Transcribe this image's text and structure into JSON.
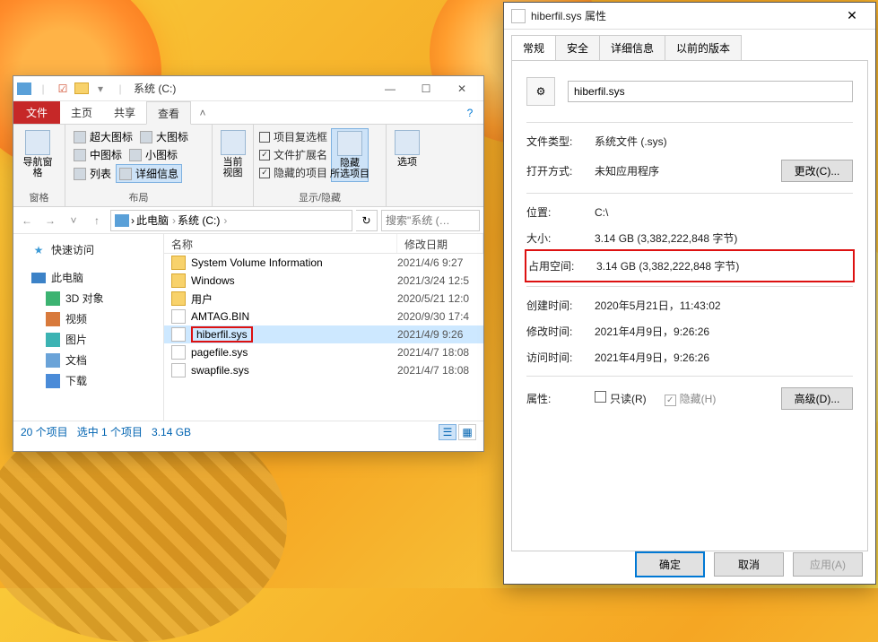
{
  "explorer": {
    "title": "系统 (C:)",
    "tabs": {
      "file": "文件",
      "home": "主页",
      "share": "共享",
      "view": "查看"
    },
    "ribbon": {
      "pane_group": "窗格",
      "nav_pane": "导航窗格",
      "layout_group": "布局",
      "xl_icons": "超大图标",
      "l_icons": "大图标",
      "m_icons": "中图标",
      "s_icons": "小图标",
      "list": "列表",
      "details": "详细信息",
      "current_view": "当前\n视图",
      "show_hide_group": "显示/隐藏",
      "chk_itemchk": "项目复选框",
      "chk_ext": "文件扩展名",
      "chk_hidden": "隐藏的项目",
      "hide_sel": "隐藏\n所选项目",
      "options": "选项"
    },
    "breadcrumbs": [
      "此电脑",
      "系统 (C:)"
    ],
    "search_placeholder": "搜索\"系统 (…",
    "nav": {
      "quick": "快速访问",
      "thispc": "此电脑",
      "objects3d": "3D 对象",
      "videos": "视频",
      "pictures": "图片",
      "documents": "文档",
      "downloads": "下载"
    },
    "columns": {
      "name": "名称",
      "date": "修改日期"
    },
    "rows": [
      {
        "type": "folder",
        "name": "System Volume Information",
        "date": "2021/4/6 9:27"
      },
      {
        "type": "folder",
        "name": "Windows",
        "date": "2021/3/24 12:5"
      },
      {
        "type": "folder",
        "name": "用户",
        "date": "2020/5/21 12:0"
      },
      {
        "type": "file",
        "name": "AMTAG.BIN",
        "date": "2020/9/30 17:4"
      },
      {
        "type": "file",
        "name": "hiberfil.sys",
        "date": "2021/4/9 9:26",
        "selected": true,
        "highlighted": true
      },
      {
        "type": "file",
        "name": "pagefile.sys",
        "date": "2021/4/7 18:08"
      },
      {
        "type": "file",
        "name": "swapfile.sys",
        "date": "2021/4/7 18:08"
      }
    ],
    "status": {
      "count": "20 个项目",
      "selected": "选中 1 个项目",
      "size": "3.14 GB"
    }
  },
  "props": {
    "title": "hiberfil.sys 属性",
    "tabs": {
      "general": "常规",
      "security": "安全",
      "details": "详细信息",
      "prev": "以前的版本"
    },
    "filename": "hiberfil.sys",
    "labels": {
      "filetype": "文件类型:",
      "filetype_v": "系统文件 (.sys)",
      "openwith": "打开方式:",
      "openwith_v": "未知应用程序",
      "change": "更改(C)...",
      "location": "位置:",
      "location_v": "C:\\",
      "size": "大小:",
      "size_v": "3.14 GB (3,382,222,848 字节)",
      "sizeondisk": "占用空间:",
      "sizeondisk_v": "3.14 GB (3,382,222,848 字节)",
      "created": "创建时间:",
      "created_v": "2020年5月21日，11:43:02",
      "modified": "修改时间:",
      "modified_v": "2021年4月9日，9:26:26",
      "accessed": "访问时间:",
      "accessed_v": "2021年4月9日，9:26:26",
      "attributes": "属性:",
      "readonly": "只读(R)",
      "hidden": "隐藏(H)",
      "advanced": "高级(D)..."
    },
    "buttons": {
      "ok": "确定",
      "cancel": "取消",
      "apply": "应用(A)"
    }
  }
}
